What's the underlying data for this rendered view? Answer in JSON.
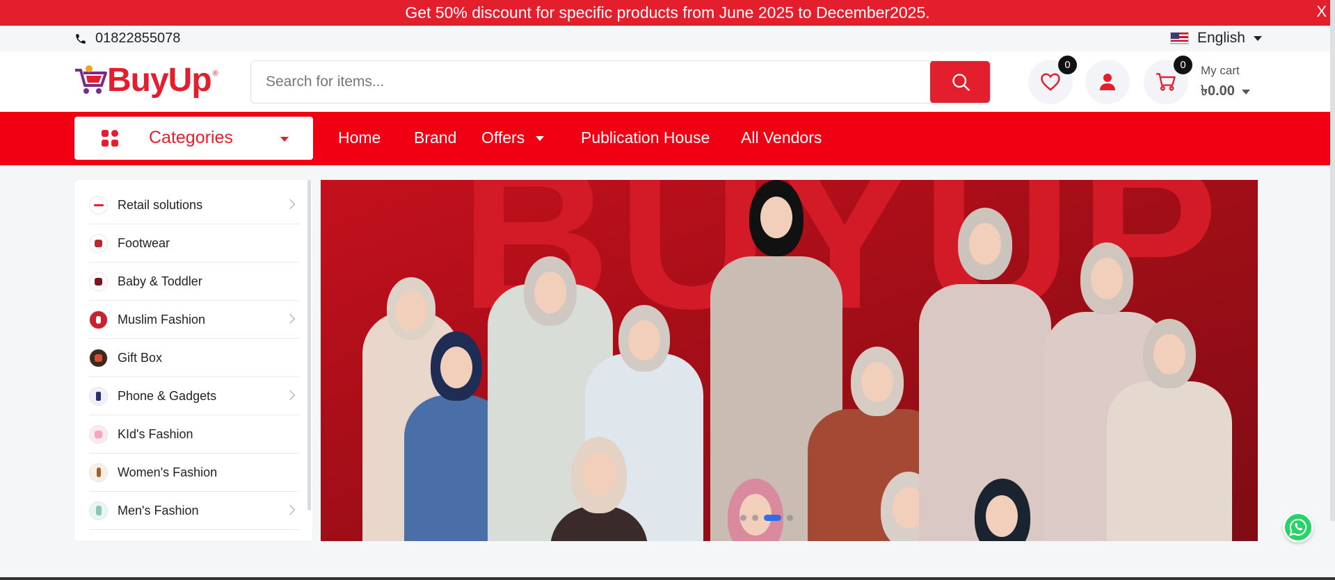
{
  "announcement": {
    "text": "Get 50% discount for specific products from June 2025 to December2025.",
    "close_label": "X"
  },
  "topbar": {
    "phone": "01822855078",
    "language": "English",
    "flag_icon": "us-flag-icon"
  },
  "header": {
    "logo_text": "BuyUp",
    "logo_mark": "®",
    "search_placeholder": "Search for items...",
    "wishlist_count": "0",
    "cart_count": "0",
    "cart_label": "My cart",
    "cart_amount": "৳0.00"
  },
  "nav": {
    "categories_label": "Categories",
    "links": [
      "Home",
      "Brand",
      "Offers",
      "Publication House",
      "All Vendors"
    ]
  },
  "sidebar": {
    "items": [
      {
        "label": "Retail solutions",
        "has_children": true
      },
      {
        "label": "Footwear",
        "has_children": false
      },
      {
        "label": "Baby & Toddler",
        "has_children": false
      },
      {
        "label": "Muslim Fashion",
        "has_children": true
      },
      {
        "label": "Gift Box",
        "has_children": false
      },
      {
        "label": "Phone & Gadgets",
        "has_children": true
      },
      {
        "label": "KId's Fashion",
        "has_children": false
      },
      {
        "label": "Women's Fashion",
        "has_children": false
      },
      {
        "label": "Men's Fashion",
        "has_children": true
      }
    ]
  },
  "banner": {
    "background_word": "BUYUP",
    "slide_count": 4,
    "active_slide": 3
  },
  "colors": {
    "brand_red": "#e31e2d",
    "nav_red": "#f10014",
    "whatsapp": "#25d366"
  }
}
